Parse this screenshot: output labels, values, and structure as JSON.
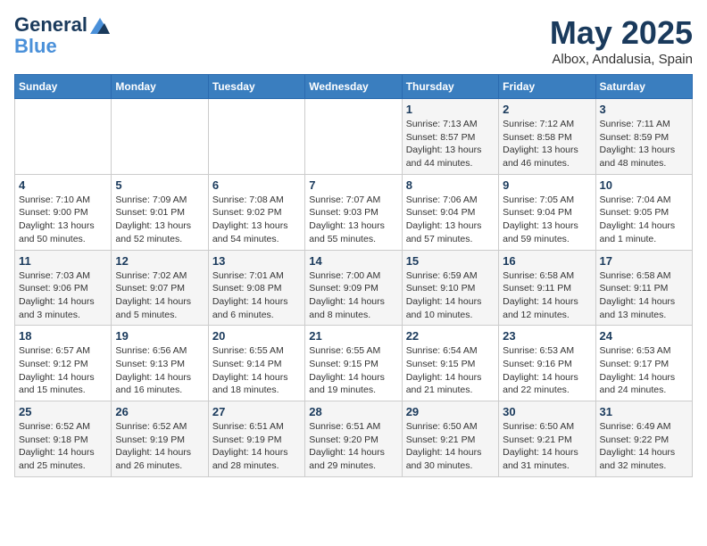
{
  "header": {
    "logo_line1": "General",
    "logo_line2": "Blue",
    "month": "May 2025",
    "location": "Albox, Andalusia, Spain"
  },
  "weekdays": [
    "Sunday",
    "Monday",
    "Tuesday",
    "Wednesday",
    "Thursday",
    "Friday",
    "Saturday"
  ],
  "weeks": [
    [
      {
        "day": "",
        "info": ""
      },
      {
        "day": "",
        "info": ""
      },
      {
        "day": "",
        "info": ""
      },
      {
        "day": "",
        "info": ""
      },
      {
        "day": "1",
        "info": "Sunrise: 7:13 AM\nSunset: 8:57 PM\nDaylight: 13 hours and 44 minutes."
      },
      {
        "day": "2",
        "info": "Sunrise: 7:12 AM\nSunset: 8:58 PM\nDaylight: 13 hours and 46 minutes."
      },
      {
        "day": "3",
        "info": "Sunrise: 7:11 AM\nSunset: 8:59 PM\nDaylight: 13 hours and 48 minutes."
      }
    ],
    [
      {
        "day": "4",
        "info": "Sunrise: 7:10 AM\nSunset: 9:00 PM\nDaylight: 13 hours and 50 minutes."
      },
      {
        "day": "5",
        "info": "Sunrise: 7:09 AM\nSunset: 9:01 PM\nDaylight: 13 hours and 52 minutes."
      },
      {
        "day": "6",
        "info": "Sunrise: 7:08 AM\nSunset: 9:02 PM\nDaylight: 13 hours and 54 minutes."
      },
      {
        "day": "7",
        "info": "Sunrise: 7:07 AM\nSunset: 9:03 PM\nDaylight: 13 hours and 55 minutes."
      },
      {
        "day": "8",
        "info": "Sunrise: 7:06 AM\nSunset: 9:04 PM\nDaylight: 13 hours and 57 minutes."
      },
      {
        "day": "9",
        "info": "Sunrise: 7:05 AM\nSunset: 9:04 PM\nDaylight: 13 hours and 59 minutes."
      },
      {
        "day": "10",
        "info": "Sunrise: 7:04 AM\nSunset: 9:05 PM\nDaylight: 14 hours and 1 minute."
      }
    ],
    [
      {
        "day": "11",
        "info": "Sunrise: 7:03 AM\nSunset: 9:06 PM\nDaylight: 14 hours and 3 minutes."
      },
      {
        "day": "12",
        "info": "Sunrise: 7:02 AM\nSunset: 9:07 PM\nDaylight: 14 hours and 5 minutes."
      },
      {
        "day": "13",
        "info": "Sunrise: 7:01 AM\nSunset: 9:08 PM\nDaylight: 14 hours and 6 minutes."
      },
      {
        "day": "14",
        "info": "Sunrise: 7:00 AM\nSunset: 9:09 PM\nDaylight: 14 hours and 8 minutes."
      },
      {
        "day": "15",
        "info": "Sunrise: 6:59 AM\nSunset: 9:10 PM\nDaylight: 14 hours and 10 minutes."
      },
      {
        "day": "16",
        "info": "Sunrise: 6:58 AM\nSunset: 9:11 PM\nDaylight: 14 hours and 12 minutes."
      },
      {
        "day": "17",
        "info": "Sunrise: 6:58 AM\nSunset: 9:11 PM\nDaylight: 14 hours and 13 minutes."
      }
    ],
    [
      {
        "day": "18",
        "info": "Sunrise: 6:57 AM\nSunset: 9:12 PM\nDaylight: 14 hours and 15 minutes."
      },
      {
        "day": "19",
        "info": "Sunrise: 6:56 AM\nSunset: 9:13 PM\nDaylight: 14 hours and 16 minutes."
      },
      {
        "day": "20",
        "info": "Sunrise: 6:55 AM\nSunset: 9:14 PM\nDaylight: 14 hours and 18 minutes."
      },
      {
        "day": "21",
        "info": "Sunrise: 6:55 AM\nSunset: 9:15 PM\nDaylight: 14 hours and 19 minutes."
      },
      {
        "day": "22",
        "info": "Sunrise: 6:54 AM\nSunset: 9:15 PM\nDaylight: 14 hours and 21 minutes."
      },
      {
        "day": "23",
        "info": "Sunrise: 6:53 AM\nSunset: 9:16 PM\nDaylight: 14 hours and 22 minutes."
      },
      {
        "day": "24",
        "info": "Sunrise: 6:53 AM\nSunset: 9:17 PM\nDaylight: 14 hours and 24 minutes."
      }
    ],
    [
      {
        "day": "25",
        "info": "Sunrise: 6:52 AM\nSunset: 9:18 PM\nDaylight: 14 hours and 25 minutes."
      },
      {
        "day": "26",
        "info": "Sunrise: 6:52 AM\nSunset: 9:19 PM\nDaylight: 14 hours and 26 minutes."
      },
      {
        "day": "27",
        "info": "Sunrise: 6:51 AM\nSunset: 9:19 PM\nDaylight: 14 hours and 28 minutes."
      },
      {
        "day": "28",
        "info": "Sunrise: 6:51 AM\nSunset: 9:20 PM\nDaylight: 14 hours and 29 minutes."
      },
      {
        "day": "29",
        "info": "Sunrise: 6:50 AM\nSunset: 9:21 PM\nDaylight: 14 hours and 30 minutes."
      },
      {
        "day": "30",
        "info": "Sunrise: 6:50 AM\nSunset: 9:21 PM\nDaylight: 14 hours and 31 minutes."
      },
      {
        "day": "31",
        "info": "Sunrise: 6:49 AM\nSunset: 9:22 PM\nDaylight: 14 hours and 32 minutes."
      }
    ]
  ]
}
